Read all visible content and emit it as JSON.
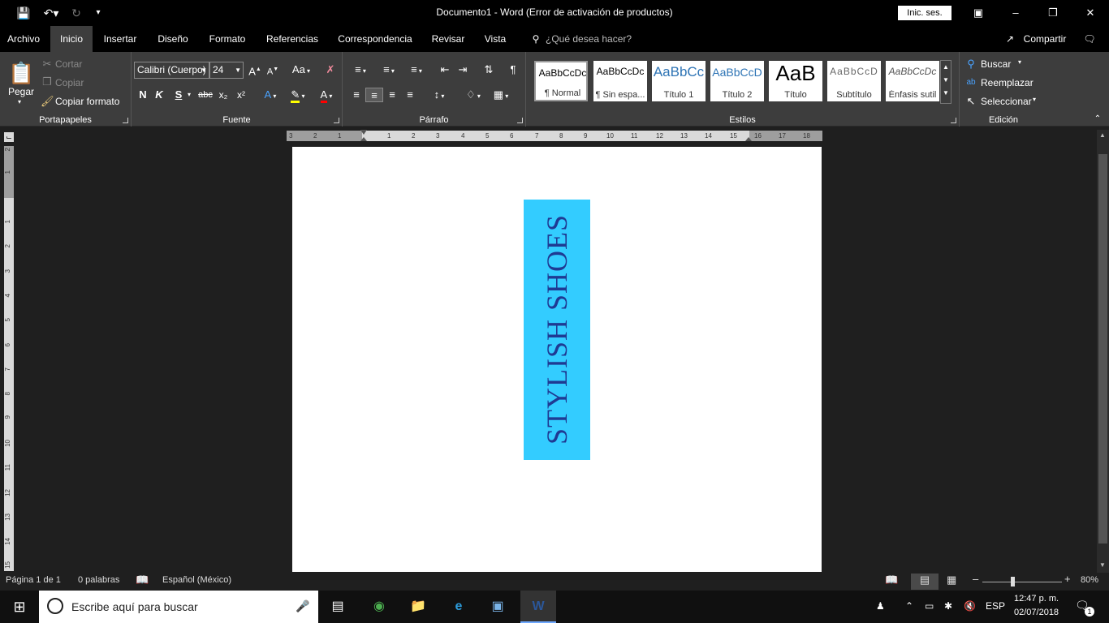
{
  "window": {
    "title": "Documento1  -  Word (Error de activación de productos)",
    "signin": "Inic. ses."
  },
  "tabs": [
    "Archivo",
    "Inicio",
    "Insertar",
    "Diseño",
    "Formato",
    "Referencias",
    "Correspondencia",
    "Revisar",
    "Vista"
  ],
  "tell_me": "¿Qué desea hacer?",
  "share": "Compartir",
  "clipboard": {
    "label": "Portapapeles",
    "paste": "Pegar",
    "cut": "Cortar",
    "copy": "Copiar",
    "format_painter": "Copiar formato"
  },
  "font": {
    "label": "Fuente",
    "family": "Calibri (Cuerpo)",
    "size": "24",
    "bold": "N",
    "italic": "K",
    "underline": "S",
    "strike": "abc",
    "subscript": "x₂",
    "superscript": "x²",
    "case": "Aa"
  },
  "paragraph": {
    "label": "Párrafo"
  },
  "styles": {
    "label": "Estilos",
    "items": [
      {
        "preview": "AaBbCcDc",
        "name": "¶ Normal"
      },
      {
        "preview": "AaBbCcDc",
        "name": "¶ Sin espa..."
      },
      {
        "preview": "AaBbCc",
        "name": "Título 1"
      },
      {
        "preview": "AaBbCcD",
        "name": "Título 2"
      },
      {
        "preview": "AaB",
        "name": "Título"
      },
      {
        "preview": "AaBbCcD",
        "name": "Subtítulo"
      },
      {
        "preview": "AaBbCcDc",
        "name": "Énfasis sutil"
      }
    ]
  },
  "editing": {
    "label": "Edición",
    "find": "Buscar",
    "replace": "Reemplazar",
    "select": "Seleccionar"
  },
  "hruler": [
    "3",
    "2",
    "1",
    "1",
    "2",
    "3",
    "4",
    "5",
    "6",
    "7",
    "8",
    "9",
    "10",
    "11",
    "12",
    "13",
    "14",
    "15",
    "16",
    "17",
    "18"
  ],
  "vruler": [
    "2",
    "1",
    "1",
    "2",
    "3",
    "4",
    "5",
    "6",
    "7",
    "8",
    "9",
    "10",
    "11",
    "12",
    "13",
    "14",
    "15"
  ],
  "document": {
    "textbox_text": "STYLISH SHOES"
  },
  "status": {
    "page": "Página 1 de 1",
    "words": "0 palabras",
    "language": "Español (México)",
    "zoom": "80%"
  },
  "taskbar": {
    "search_placeholder": "Escribe aquí para buscar",
    "lang": "ESP",
    "time": "12:47 p. m.",
    "date": "02/07/2018",
    "notif_count": "1"
  },
  "colors": {
    "textbox_fill": "#33ccff",
    "textbox_text": "#1f3a93",
    "ribbon": "#3d3d3d",
    "titlebar": "#000000"
  }
}
